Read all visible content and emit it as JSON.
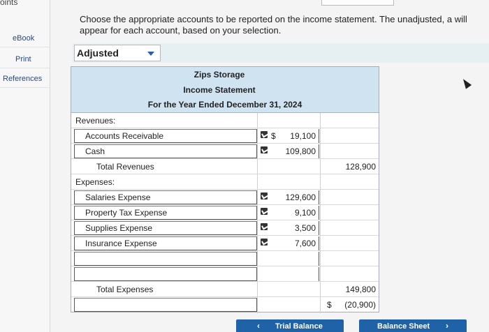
{
  "sidebar": {
    "points_label": "oints",
    "items": [
      {
        "label": "eBook"
      },
      {
        "label": "Print"
      },
      {
        "label": "References"
      }
    ]
  },
  "instructions": "Choose the appropriate accounts to be reported on the income statement. The unadjusted, a will appear for each account, based on your selection.",
  "dropdown": {
    "selected": "Adjusted"
  },
  "statement": {
    "company": "Zips Storage",
    "title": "Income Statement",
    "period": "For the Year Ended December 31, 2024",
    "revenues_label": "Revenues:",
    "revenues": [
      {
        "account": "Accounts Receivable",
        "dollar": "$",
        "amount": "19,100"
      },
      {
        "account": "Cash",
        "dollar": "",
        "amount": "109,800"
      }
    ],
    "total_revenues_label": "Total Revenues",
    "total_revenues": "128,900",
    "expenses_label": "Expenses:",
    "expenses": [
      {
        "account": "Salaries Expense",
        "amount": "129,600"
      },
      {
        "account": "Property Tax Expense",
        "amount": "9,100"
      },
      {
        "account": "Supplies Expense",
        "amount": "3,500"
      },
      {
        "account": "Insurance Expense",
        "amount": "7,600"
      }
    ],
    "total_expenses_label": "Total Expenses",
    "total_expenses": "149,800",
    "net_dollar": "$",
    "net_amount": "(20,900)"
  },
  "nav": {
    "prev_label": "Trial Balance",
    "next_label": "Balance Sheet"
  },
  "colors": {
    "header_bg": "#cfe3f1",
    "button_bg": "#1f62a8",
    "highlight_bg": "#e6f0f3"
  }
}
